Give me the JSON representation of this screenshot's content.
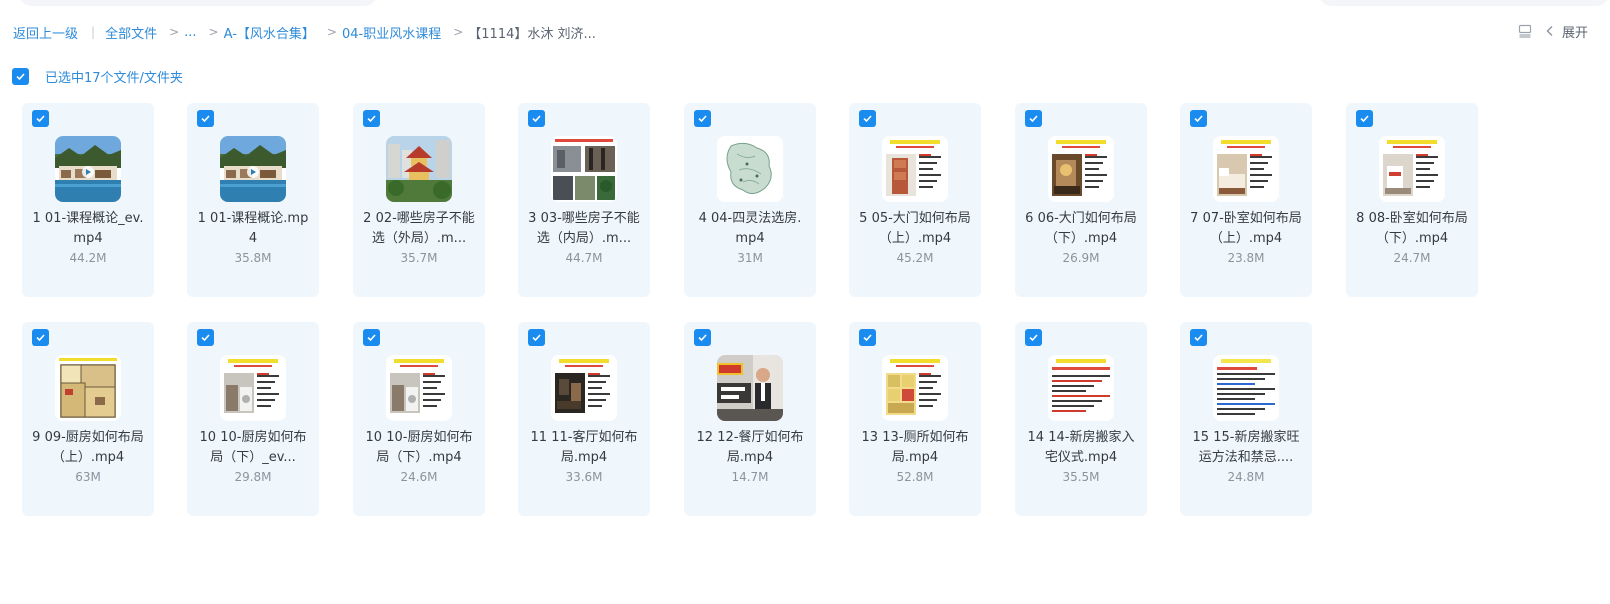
{
  "breadcrumb": {
    "back": "返回上一级",
    "all_files": "全部文件",
    "ellipsis": "...",
    "folder1": "A-【风水合集】",
    "folder2": "04-职业风水课程",
    "current": "【1114】水沐 刘济..."
  },
  "toolbar": {
    "expand_label": "展开"
  },
  "selection": {
    "label": "已选中17个文件/文件夹"
  },
  "files": [
    {
      "name_line1": "1 01-课程概论_ev.",
      "name_line2": "mp4",
      "size": "44.2M",
      "thumb": "resort"
    },
    {
      "name_line1": "1 01-课程概论.mp",
      "name_line2": "4",
      "size": "35.8M",
      "thumb": "resort"
    },
    {
      "name_line1": "2 02-哪些房子不能",
      "name_line2": "选（外局）.m...",
      "size": "35.7M",
      "thumb": "pagoda"
    },
    {
      "name_line1": "3 03-哪些房子不能",
      "name_line2": "选（内局）.m...",
      "size": "44.7M",
      "thumb": "collage"
    },
    {
      "name_line1": "4 04-四灵法选房.",
      "name_line2": "mp4",
      "size": "31M",
      "thumb": "map"
    },
    {
      "name_line1": "5 05-大门如何布局",
      "name_line2": "（上）.mp4",
      "size": "45.2M",
      "thumb": "slide-door"
    },
    {
      "name_line1": "6 06-大门如何布局",
      "name_line2": "（下）.mp4",
      "size": "26.9M",
      "thumb": "slide-room"
    },
    {
      "name_line1": "7 07-卧室如何布局",
      "name_line2": "（上）.mp4",
      "size": "23.8M",
      "thumb": "slide-bed"
    },
    {
      "name_line1": "8 08-卧室如何布局",
      "name_line2": "（下）.mp4",
      "size": "24.7M",
      "thumb": "slide-bed2"
    },
    {
      "name_line1": "9 09-厨房如何布局",
      "name_line2": "（上）.mp4",
      "size": "63M",
      "thumb": "floorplan"
    },
    {
      "name_line1": "10 10-厨房如何布",
      "name_line2": "局（下）_ev...",
      "size": "29.8M",
      "thumb": "slide-kitchen"
    },
    {
      "name_line1": "10 10-厨房如何布",
      "name_line2": "局（下）.mp4",
      "size": "24.6M",
      "thumb": "slide-kitchen"
    },
    {
      "name_line1": "11 11-客厅如何布",
      "name_line2": "局.mp4",
      "size": "33.6M",
      "thumb": "slide-dark"
    },
    {
      "name_line1": "12 12-餐厅如何布",
      "name_line2": "局.mp4",
      "size": "14.7M",
      "thumb": "presenter"
    },
    {
      "name_line1": "13 13-厕所如何布",
      "name_line2": "局.mp4",
      "size": "52.8M",
      "thumb": "slide-toilet"
    },
    {
      "name_line1": "14 14-新房搬家入",
      "name_line2": "宅仪式.mp4",
      "size": "35.5M",
      "thumb": "slide-text"
    },
    {
      "name_line1": "15 15-新房搬家旺",
      "name_line2": "运方法和禁忌....",
      "size": "24.8M",
      "thumb": "slide-text2"
    }
  ],
  "colors": {
    "accent": "#1a8cf0",
    "link": "#2f8bd8",
    "card_bg": "#f0f7fc"
  }
}
